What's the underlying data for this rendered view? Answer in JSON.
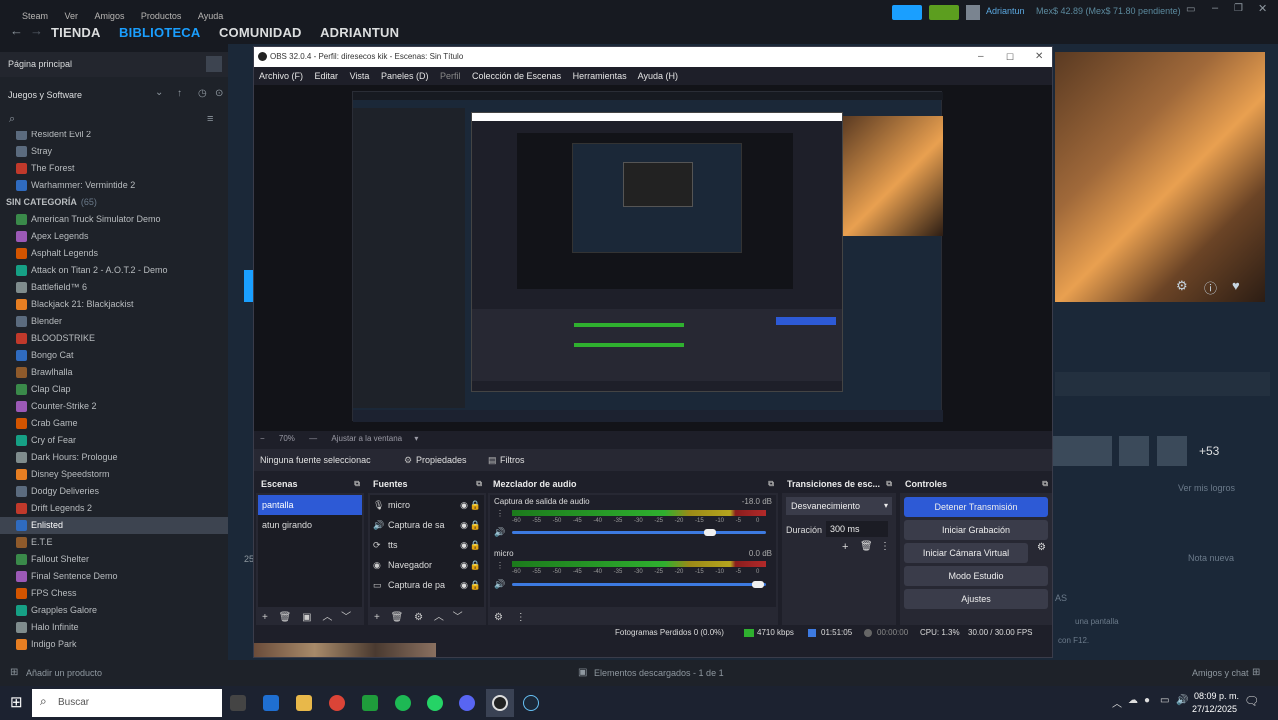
{
  "steam": {
    "menu": [
      "Steam",
      "Ver",
      "Amigos",
      "Productos",
      "Ayuda"
    ],
    "nav": [
      "TIENDA",
      "BIBLIOTECA",
      "COMUNIDAD",
      "ADRIANTUN"
    ],
    "user": "Adriantun",
    "wallet": "Mex$ 42.89 (Mex$ 71.80 pendiente)",
    "home": "Página principal",
    "filter": "Juegos y Software",
    "games_top": [
      "Resident Evil 2",
      "Stray",
      "The Forest",
      "Warhammer: Vermintide 2"
    ],
    "category_label": "SIN CATEGORÍA",
    "category_count": "(65)",
    "games": [
      "American Truck Simulator Demo",
      "Apex Legends",
      "Asphalt Legends",
      "Attack on Titan 2 - A.O.T.2 - Demo",
      "Battlefield™ 6",
      "Blackjack 21: Blackjackist",
      "Blender",
      "BLOODSTRIKE",
      "Bongo Cat",
      "Brawlhalla",
      "Clap Clap",
      "Counter-Strike 2",
      "Crab Game",
      "Cry of Fear",
      "Dark Hours: Prologue",
      "Disney Speedstorm",
      "Dodgy Deliveries",
      "Drift Legends 2",
      "Enlisted",
      "E.T.E",
      "Fallout Shelter",
      "Final Sentence Demo",
      "FPS Chess",
      "Grapples Galore",
      "Halo Infinite",
      "Indigo Park"
    ],
    "selected_game": "Enlisted",
    "add_product": "Añadir un producto",
    "downloads": "Elementos descargados - 1 de 1",
    "friends_chat": "Amigos y chat",
    "achievements_more": "+53",
    "achievements_link": "Ver mis logros",
    "new_note": "Nota nueva",
    "screenshot_hint_1": "una pantalla",
    "screenshot_hint_2": "con F12.",
    "side_as": "AS",
    "side_num": "25"
  },
  "obs": {
    "title": "OBS 32.0.4 - Perfil: diresecos kik - Escenas: Sin Título",
    "menu": [
      "Archivo (F)",
      "Editar",
      "Vista",
      "Paneles (D)",
      "Perfil",
      "Colección de Escenas",
      "Herramientas",
      "Ayuda (H)"
    ],
    "zoom": "70%",
    "fit": "Ajustar a la ventana",
    "no_source": "Ninguna fuente seleccionac",
    "properties": "Propiedades",
    "filters": "Filtros",
    "scenes_title": "Escenas",
    "scenes": [
      "pantalla",
      "atun girando"
    ],
    "sources_title": "Fuentes",
    "sources": [
      "micro",
      "Captura de sa",
      "tts",
      "Navegador",
      "Captura de pa"
    ],
    "mixer_title": "Mezclador de audio",
    "mixer": [
      {
        "name": "Captura de salida de audio",
        "db": "-18.0 dB",
        "level": 0.78
      },
      {
        "name": "micro",
        "db": "0.0 dB",
        "level": 0.97
      }
    ],
    "scale_ticks": [
      "-60",
      "-55",
      "-50",
      "-45",
      "-40",
      "-35",
      "-30",
      "-25",
      "-20",
      "-15",
      "-10",
      "-5",
      "0"
    ],
    "transitions_title": "Transiciones de esc...",
    "transition": "Desvanecimiento",
    "duration_label": "Duración",
    "duration": "300 ms",
    "controls_title": "Controles",
    "controls": [
      "Detener Transmisión",
      "Iniciar Grabación",
      "Iniciar Cámara Virtual",
      "Modo Estudio",
      "Ajustes"
    ],
    "status": {
      "dropped": "Fotogramas Perdidos 0 (0.0%)",
      "kbps": "4710 kbps",
      "live_time": "01:51:05",
      "rec_time": "00:00:00",
      "cpu": "CPU: 1.3%",
      "fps": "30.00 / 30.00 FPS"
    }
  },
  "taskbar": {
    "search_placeholder": "Buscar",
    "time": "08:09 p. m.",
    "date": "27/12/2025"
  },
  "colors": {
    "steam_blue": "#1a9fff",
    "obs_primary": "#2d5ad6",
    "scene_selected": "#2d5ad6"
  }
}
